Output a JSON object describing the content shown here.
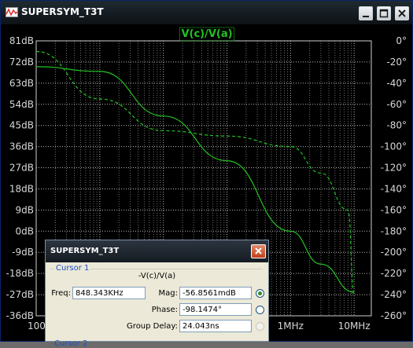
{
  "window": {
    "title": "SUPERSYM_T3T"
  },
  "trace_label": "V(c)/V(a)",
  "colors": {
    "grid": "#b8b8b8",
    "trace": "#22c322",
    "background": "#000000",
    "tick_text": "#d8d8d8"
  },
  "chart_data": {
    "type": "line",
    "x_scale": "log",
    "left_axis": {
      "unit": "dB",
      "range": [
        -36,
        81
      ],
      "ticks": [
        "81dB",
        "72dB",
        "63dB",
        "54dB",
        "45dB",
        "36dB",
        "27dB",
        "18dB",
        "9dB",
        "0dB",
        "-9dB",
        "-18dB",
        "-27dB",
        "-36dB"
      ]
    },
    "right_axis": {
      "unit": "°",
      "range": [
        -260,
        0
      ],
      "ticks": [
        "0°",
        "-20°",
        "-40°",
        "-60°",
        "-80°",
        "-100°",
        "-120°",
        "-140°",
        "-160°",
        "-180°",
        "-200°",
        "-220°",
        "-240°",
        "-260°"
      ]
    },
    "x_ticks_visible": [
      "100",
      "1MHz",
      "10MHz"
    ],
    "grid": true,
    "series": [
      {
        "name": "V(c)/V(a)",
        "style": "solid",
        "axis": "left",
        "x": [
          100,
          1000,
          10000,
          100000,
          1000000,
          3000000,
          10000000
        ],
        "values": [
          70,
          68,
          49,
          30,
          0,
          -14,
          -26
        ]
      },
      {
        "name": "V(c)/V(a)",
        "style": "dashed",
        "axis": "right",
        "x": [
          100,
          1000,
          10000,
          100000,
          1000000,
          3000000,
          8000000,
          10000000
        ],
        "values": [
          -10,
          -55,
          -85,
          -90,
          -100,
          -125,
          -160,
          -240
        ]
      }
    ]
  },
  "cursor_dialog": {
    "title": "SUPERSYM_T3T",
    "group1_label": "Cursor 1",
    "expression": "-V(c)/V(a)",
    "freq_label": "Freq:",
    "freq_value": "848.343KHz",
    "mag_label": "Mag:",
    "mag_value": "-56.8561mdB",
    "phase_label": "Phase:",
    "phase_value": "-98.1474°",
    "group_delay_label": "Group Delay:",
    "group_delay_value": "24.043ns",
    "group2_label": "Cursor 2"
  }
}
